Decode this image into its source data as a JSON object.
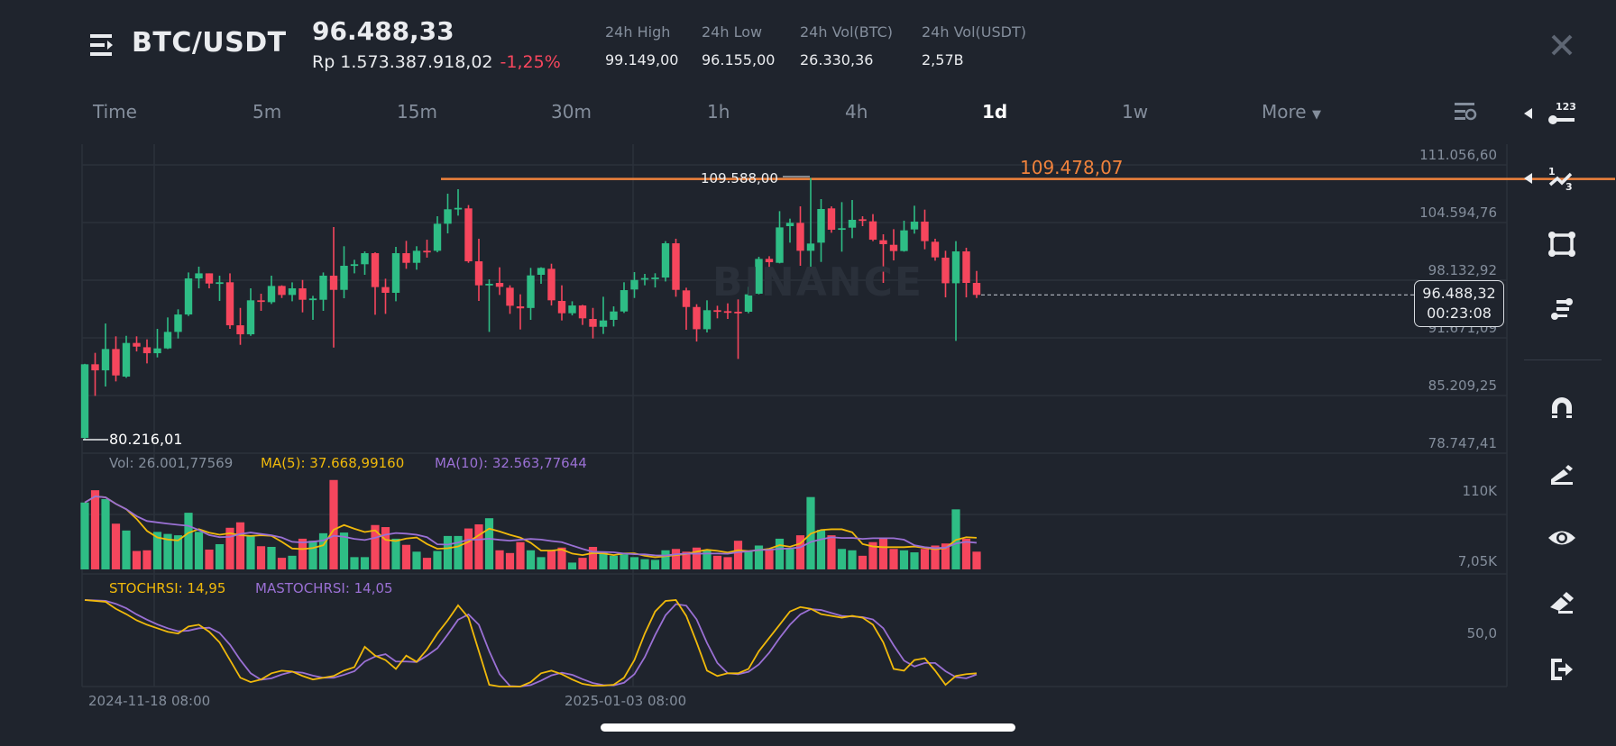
{
  "header": {
    "pair": "BTC/USDT",
    "last_price": "96.488,33",
    "fiat_price": "Rp 1.573.387.918,02",
    "change_pct": "-1,25%",
    "stats": [
      {
        "label": "24h High",
        "value": "99.149,00"
      },
      {
        "label": "24h Low",
        "value": "96.155,00"
      },
      {
        "label": "24h Vol(BTC)",
        "value": "26.330,36"
      },
      {
        "label": "24h Vol(USDT)",
        "value": "2,57B"
      }
    ]
  },
  "timeframes": [
    {
      "label": "Time",
      "active": false
    },
    {
      "label": "5m",
      "active": false
    },
    {
      "label": "15m",
      "active": false
    },
    {
      "label": "30m",
      "active": false
    },
    {
      "label": "1h",
      "active": false
    },
    {
      "label": "4h",
      "active": false
    },
    {
      "label": "1d",
      "active": true
    },
    {
      "label": "1w",
      "active": false
    },
    {
      "label": "More",
      "active": false
    }
  ],
  "toolbar": [
    "close-icon",
    "price-label-tool-icon",
    "fibonacci-tool-icon",
    "rectangle-tool-icon",
    "position-tool-icon",
    "magnet-icon",
    "draw-pen-icon",
    "visibility-eye-icon",
    "eraser-icon",
    "exit-icon"
  ],
  "colors": {
    "up": "#2ebd85",
    "down": "#f6465d",
    "ma5": "#f0b90b",
    "ma10": "#9a70d4",
    "alert": "#f0823c"
  },
  "watermark": "BINANCE",
  "chart_data": {
    "type": "candlestick",
    "interval": "1d",
    "price_axis": {
      "max": 111056.6,
      "step": 6461.84,
      "ticks": [
        "111.056,60",
        "104.594,76",
        "98.132,92",
        "91.671,09",
        "85.209,25",
        "78.747,41"
      ]
    },
    "x_ticks": [
      "2024-11-18 08:00",
      "2025-01-03 08:00"
    ],
    "annotations": {
      "high_label": "109.588,00",
      "low_label": "80.216,01",
      "alert_line": {
        "value": 109478.07,
        "label": "109.478,07"
      },
      "current": {
        "value": 96488.32,
        "label": "96.488,32",
        "countdown": "00:23:08"
      }
    },
    "candles": [
      [
        80460,
        88760,
        80216,
        88710
      ],
      [
        88710,
        89990,
        85170,
        88030
      ],
      [
        88030,
        93280,
        86220,
        90420
      ],
      [
        90420,
        91840,
        86790,
        87460
      ],
      [
        87330,
        91900,
        87190,
        91100
      ],
      [
        91100,
        91840,
        90150,
        90690
      ],
      [
        90620,
        91500,
        88810,
        89950
      ],
      [
        89950,
        92680,
        89480,
        90490
      ],
      [
        90490,
        93960,
        90420,
        92340
      ],
      [
        92340,
        94870,
        91600,
        94290
      ],
      [
        94290,
        99000,
        94120,
        98330
      ],
      [
        98330,
        99650,
        97220,
        98900
      ],
      [
        98900,
        98900,
        97220,
        97760
      ],
      [
        97830,
        98640,
        95810,
        97900
      ],
      [
        97900,
        98900,
        92680,
        93080
      ],
      [
        93080,
        95030,
        90890,
        92070
      ],
      [
        92070,
        97220,
        91900,
        95880
      ],
      [
        95880,
        96620,
        94700,
        95770
      ],
      [
        95670,
        98640,
        95470,
        97490
      ],
      [
        97490,
        97560,
        96140,
        96480
      ],
      [
        96480,
        97890,
        95770,
        97220
      ],
      [
        97220,
        98160,
        94530,
        95940
      ],
      [
        96010,
        96380,
        93690,
        96080
      ],
      [
        95940,
        99000,
        94700,
        98640
      ],
      [
        98640,
        104090,
        90590,
        97050
      ],
      [
        97050,
        101940,
        96110,
        99750
      ],
      [
        99850,
        100420,
        98900,
        99920
      ],
      [
        99920,
        101360,
        98740,
        101160
      ],
      [
        101160,
        101260,
        94260,
        97360
      ],
      [
        97360,
        98300,
        94360,
        96720
      ],
      [
        96720,
        101870,
        95770,
        101160
      ],
      [
        101160,
        102540,
        99410,
        100080
      ],
      [
        100080,
        101940,
        99310,
        101430
      ],
      [
        101430,
        102670,
        100660,
        101330
      ],
      [
        101430,
        105300,
        101260,
        104460
      ],
      [
        104460,
        107830,
        103380,
        106080
      ],
      [
        106180,
        108330,
        105370,
        106240
      ],
      [
        106180,
        106550,
        100080,
        100250
      ],
      [
        100250,
        102780,
        95810,
        97560
      ],
      [
        97630,
        98230,
        92340,
        97730
      ],
      [
        97830,
        99580,
        96480,
        97390
      ],
      [
        97290,
        97560,
        94360,
        95270
      ],
      [
        95200,
        96550,
        92610,
        94980
      ],
      [
        95020,
        99510,
        93690,
        98670
      ],
      [
        98740,
        99580,
        97730,
        99510
      ],
      [
        99410,
        99980,
        95300,
        95880
      ],
      [
        95810,
        97560,
        93620,
        94430
      ],
      [
        94430,
        95770,
        94190,
        95300
      ],
      [
        95300,
        95370,
        93120,
        93860
      ],
      [
        93790,
        95030,
        91600,
        92910
      ],
      [
        92910,
        96280,
        92110,
        93620
      ],
      [
        93690,
        95200,
        92950,
        94630
      ],
      [
        94630,
        97900,
        94460,
        97020
      ],
      [
        97090,
        99040,
        96140,
        98160
      ],
      [
        98300,
        98840,
        97560,
        98370
      ],
      [
        98370,
        98910,
        97320,
        98430
      ],
      [
        98430,
        102510,
        97990,
        102270
      ],
      [
        102270,
        102780,
        96280,
        97050
      ],
      [
        96990,
        97290,
        92580,
        95130
      ],
      [
        95130,
        95440,
        91260,
        92640
      ],
      [
        92640,
        95880,
        92280,
        94770
      ],
      [
        94770,
        95270,
        93860,
        94660
      ],
      [
        94660,
        95540,
        93790,
        94560
      ],
      [
        94600,
        95980,
        89310,
        94530
      ],
      [
        94600,
        97390,
        94430,
        96550
      ],
      [
        96620,
        100760,
        96550,
        100520
      ],
      [
        100520,
        100820,
        97390,
        100150
      ],
      [
        100080,
        105870,
        100020,
        104050
      ],
      [
        104190,
        105030,
        102340,
        104560
      ],
      [
        104560,
        106410,
        99750,
        101430
      ],
      [
        101430,
        109588,
        99650,
        102240
      ],
      [
        102340,
        107220,
        100180,
        106110
      ],
      [
        106180,
        106410,
        103450,
        103790
      ],
      [
        103890,
        106880,
        101330,
        103960
      ],
      [
        104020,
        107120,
        102840,
        104900
      ],
      [
        104960,
        105300,
        104190,
        104800
      ],
      [
        104730,
        105540,
        102510,
        102670
      ],
      [
        102610,
        103280,
        97830,
        102170
      ],
      [
        102100,
        103850,
        100350,
        101400
      ],
      [
        101400,
        104800,
        101330,
        103720
      ],
      [
        103820,
        106480,
        103350,
        104700
      ],
      [
        104700,
        106040,
        101600,
        102510
      ],
      [
        102440,
        102780,
        100320,
        100690
      ],
      [
        100660,
        101430,
        96210,
        97790
      ],
      [
        97790,
        102510,
        91330,
        101360
      ],
      [
        101360,
        101770,
        96210,
        97830
      ],
      [
        97830,
        99170,
        96140,
        96488
      ]
    ],
    "volume": {
      "label": "Vol: 26.001,77569",
      "ma5_label": "MA(5): 37.668,99160",
      "ma10_label": "MA(10): 32.563,77644",
      "axis_ticks": [
        "110K",
        "7,05K"
      ],
      "values_k": [
        98,
        116,
        103,
        67,
        57,
        27,
        28,
        55,
        52,
        50,
        83,
        55,
        29,
        37,
        61,
        69,
        49,
        34,
        33,
        17,
        20,
        45,
        42,
        53,
        131,
        54,
        18,
        18,
        65,
        62,
        45,
        36,
        26,
        17,
        27,
        49,
        49,
        60,
        66,
        75,
        28,
        24,
        40,
        28,
        18,
        28,
        32,
        10,
        17,
        33,
        25,
        20,
        22,
        18,
        15,
        14,
        28,
        30,
        26,
        32,
        28,
        20,
        18,
        42,
        26,
        35,
        30,
        45,
        30,
        50,
        106,
        58,
        50,
        30,
        28,
        20,
        40,
        45,
        30,
        28,
        25,
        30,
        35,
        38,
        88,
        45,
        26
      ]
    },
    "stochrsi": {
      "k_label": "STOCHRSI: 14,95",
      "d_label": "MASTOCHRSI: 14,05",
      "axis_tick": "50,0",
      "k": [
        98,
        97,
        96,
        88,
        82,
        75,
        70,
        66,
        62,
        60,
        68,
        70,
        62,
        50,
        30,
        10,
        5,
        8,
        15,
        18,
        17,
        12,
        8,
        10,
        12,
        18,
        22,
        45,
        35,
        30,
        20,
        35,
        28,
        42,
        60,
        75,
        92,
        78,
        40,
        2,
        0,
        0,
        0,
        5,
        15,
        18,
        14,
        8,
        3,
        1,
        1,
        2,
        10,
        30,
        60,
        85,
        97,
        98,
        80,
        50,
        18,
        12,
        15,
        15,
        20,
        40,
        55,
        70,
        85,
        90,
        88,
        82,
        80,
        78,
        80,
        78,
        70,
        50,
        20,
        18,
        30,
        32,
        18,
        2,
        12,
        14,
        15
      ]
    }
  }
}
